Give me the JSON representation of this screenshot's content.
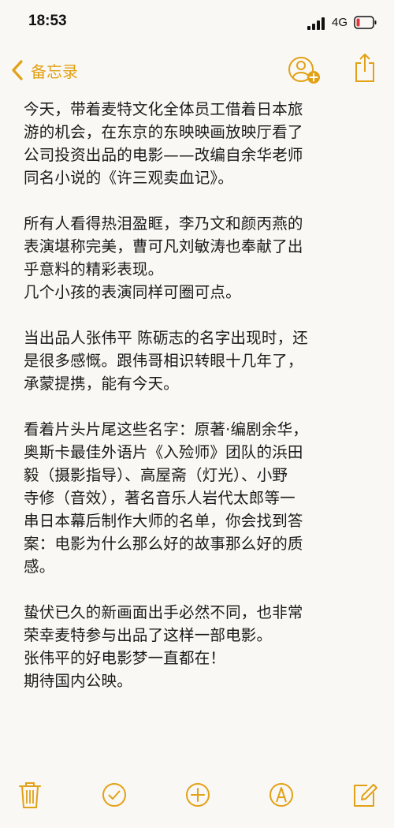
{
  "status_bar": {
    "time": "18:53",
    "network": "4G",
    "icons": [
      "signal-icon",
      "battery-icon"
    ]
  },
  "nav": {
    "back_label": "备忘录",
    "icons": [
      "chevron-left-icon",
      "add-person-icon",
      "share-icon"
    ]
  },
  "note": {
    "paragraphs": [
      [
        "今天，带着麦特文化全体员工借着日本旅",
        "游的机会，在东京的东映映画放映厅看了",
        "公司投资出品的电影——改编自余华老师",
        "同名小说的《许三观卖血记》。"
      ],
      [
        "所有人看得热泪盈眶，李乃文和颜丙燕的",
        "表演堪称完美，曹可凡刘敏涛也奉献了出",
        "乎意料的精彩表现。",
        "几个小孩的表演同样可圈可点。"
      ],
      [
        "当出品人张伟平 陈砺志的名字出现时，还",
        "是很多感慨。跟伟哥相识转眼十几年了，",
        "承蒙提携，能有今天。"
      ],
      [
        "看着片头片尾这些名字：原著·编剧余华，",
        "奥斯卡最佳外语片《入殓师》团队的浜田",
        "毅（摄影指导）、高屋斋（灯光）、小野",
        "寺修（音效），著名音乐人岩代太郎等一",
        "串日本幕后制作大师的名单，你会找到答",
        "案：电影为什么那么好的故事那么好的质",
        "感。"
      ],
      [
        "蛰伏已久的新画面出手必然不同，也非常",
        "荣幸麦特参与出品了这样一部电影。",
        "张伟平的好电影梦一直都在！",
        "期待国内公映。"
      ]
    ]
  },
  "toolbar": {
    "icons": [
      "trash-icon",
      "checklist-icon",
      "add-icon",
      "markup-icon",
      "compose-icon"
    ]
  },
  "colors": {
    "accent": "#e2a117",
    "background": "#faf8f4",
    "text": "#1a1a1a"
  }
}
